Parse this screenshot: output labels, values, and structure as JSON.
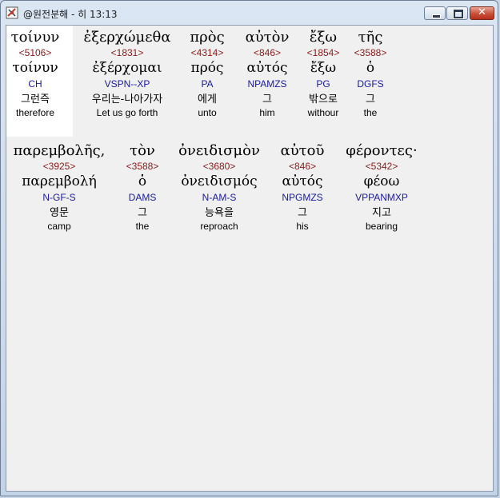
{
  "window": {
    "title": "@원전분해 - 히 13:13",
    "icon": "bible-book-icon",
    "buttons": {
      "minimize": "minimize-icon",
      "maximize": "maximize-icon",
      "close": "✕"
    }
  },
  "line1": [
    {
      "greek": "τοίνυν",
      "strong": "<5106>",
      "lemma": "τοίνυν",
      "morph": "CH",
      "korean": "그런즉",
      "english": "therefore"
    },
    {
      "greek": "ἐξερχώμεθα",
      "strong": "<1831>",
      "lemma": "ἐξέρχομαι",
      "morph": "VSPN--XP",
      "korean": "우리는-나아가자",
      "english": "Let us go forth"
    },
    {
      "greek": "πρὸς",
      "strong": "<4314>",
      "lemma": "πρός",
      "morph": "PA",
      "korean": "에게",
      "english": "unto"
    },
    {
      "greek": "αὐτὸν",
      "strong": "<846>",
      "lemma": "αὐτός",
      "morph": "NPAMZS",
      "korean": "그",
      "english": "him"
    },
    {
      "greek": "ἔξω",
      "strong": "<1854>",
      "lemma": "ἔξω",
      "morph": "PG",
      "korean": "밖으로",
      "english": "withour"
    },
    {
      "greek": "τῆς",
      "strong": "<3588>",
      "lemma": "ὁ",
      "morph": "DGFS",
      "korean": "그",
      "english": "the"
    }
  ],
  "line2": [
    {
      "greek": "παρεμβολῆς,",
      "strong": "<3925>",
      "lemma": "παρεμβολή",
      "morph": "N-GF-S",
      "korean": "영문",
      "english": "camp"
    },
    {
      "greek": "τὸν",
      "strong": "<3588>",
      "lemma": "ὁ",
      "morph": "DAMS",
      "korean": "그",
      "english": "the"
    },
    {
      "greek": "ὀνειδισμὸν",
      "strong": "<3680>",
      "lemma": "ὀνειδισμός",
      "morph": "N-AM-S",
      "korean": "능욕을",
      "english": "reproach"
    },
    {
      "greek": "αὐτοῦ",
      "strong": "<846>",
      "lemma": "αὐτός",
      "morph": "NPGMZS",
      "korean": "그",
      "english": "his"
    },
    {
      "greek": "φέροντες·",
      "strong": "<5342>",
      "lemma": "φέοω",
      "morph": "VPPANMXP",
      "korean": "지고",
      "english": "bearing"
    }
  ]
}
